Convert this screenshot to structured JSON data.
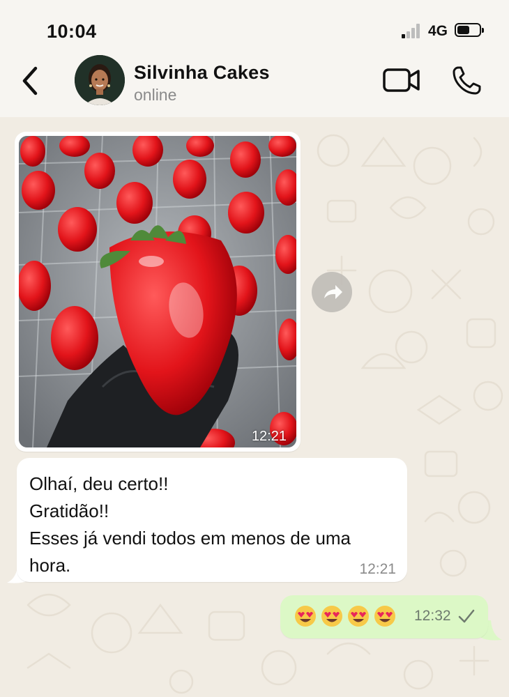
{
  "status_bar": {
    "time": "10:04",
    "network": "4G",
    "battery_level": 0.55,
    "signal_bars_active": 1
  },
  "header": {
    "contact_name": "Silvinha Cakes",
    "contact_status": "online",
    "icons": [
      "back-icon",
      "avatar",
      "video-call-icon",
      "phone-call-icon"
    ]
  },
  "messages": [
    {
      "type": "image",
      "direction": "incoming",
      "time": "12:21",
      "image": "chocolate-covered-strawberry-photo"
    },
    {
      "type": "text",
      "direction": "incoming",
      "lines": [
        "Olhaí, deu certo!!",
        "Gratidão!!",
        "Esses já vendi todos em menos de uma",
        "hora."
      ],
      "time": "12:21"
    },
    {
      "type": "text",
      "direction": "outgoing",
      "emojis": [
        "heart-eyes-emoji",
        "heart-eyes-emoji",
        "heart-eyes-emoji",
        "heart-eyes-emoji"
      ],
      "time": "12:32",
      "status": "sent-single-check"
    }
  ],
  "colors": {
    "chat_background": "#f1ece3",
    "incoming_bubble": "#ffffff",
    "outgoing_bubble": "#dcf8c6",
    "header_background": "#f7f5f1",
    "muted_text": "#8a8a8a"
  }
}
